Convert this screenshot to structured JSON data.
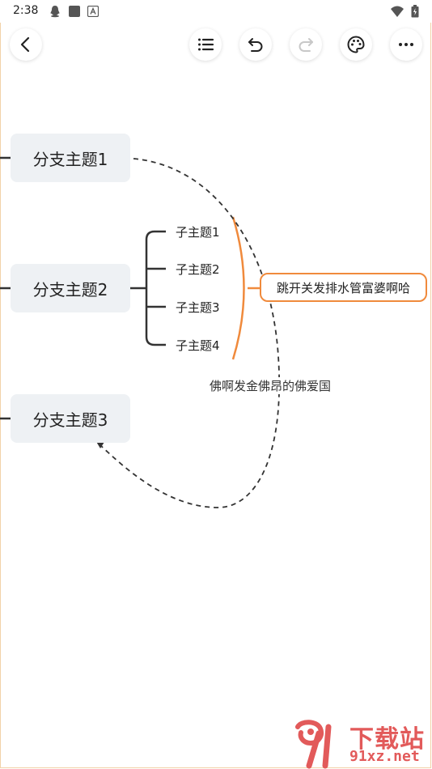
{
  "status_bar": {
    "time": "2:38",
    "icons": [
      "qq-icon",
      "square-icon",
      "a-icon",
      "wifi-icon",
      "battery-icon"
    ]
  },
  "toolbar": {
    "back": "back-icon",
    "outline": "list-icon",
    "undo": "undo-icon",
    "redo": "redo-icon",
    "theme": "palette-icon",
    "more": "more-icon"
  },
  "mindmap": {
    "branches": [
      {
        "label": "分支主题1"
      },
      {
        "label": "分支主题2"
      },
      {
        "label": "分支主题3"
      }
    ],
    "subtopics": [
      "子主题1",
      "子主题2",
      "子主题3",
      "子主题4"
    ],
    "summary": "跳开关发排水管富婆啊哈",
    "relation_label": "佛啊发金佛昂的佛爱国"
  },
  "colors": {
    "accent_orange": "#f08a3c",
    "node_bg": "#eef1f4",
    "watermark": "#e25a5a"
  },
  "watermark": {
    "top": "下载站",
    "bottom": "91xz.net"
  }
}
